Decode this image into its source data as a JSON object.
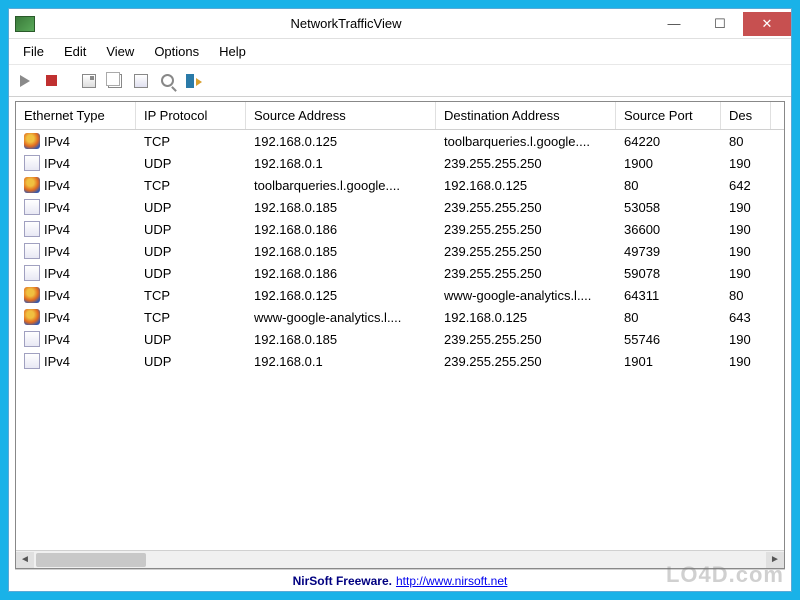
{
  "window": {
    "title": "NetworkTrafficView"
  },
  "menus": [
    "File",
    "Edit",
    "View",
    "Options",
    "Help"
  ],
  "columns": [
    "Ethernet Type",
    "IP Protocol",
    "Source Address",
    "Destination Address",
    "Source Port",
    "Des"
  ],
  "rows": [
    {
      "icon": "firefox",
      "eth": "IPv4",
      "proto": "TCP",
      "src": "192.168.0.125",
      "dst": "toolbarqueries.l.google....",
      "sport": "64220",
      "dport": "80"
    },
    {
      "icon": "generic",
      "eth": "IPv4",
      "proto": "UDP",
      "src": "192.168.0.1",
      "dst": "239.255.255.250",
      "sport": "1900",
      "dport": "190"
    },
    {
      "icon": "firefox",
      "eth": "IPv4",
      "proto": "TCP",
      "src": "toolbarqueries.l.google....",
      "dst": "192.168.0.125",
      "sport": "80",
      "dport": "642"
    },
    {
      "icon": "generic",
      "eth": "IPv4",
      "proto": "UDP",
      "src": "192.168.0.185",
      "dst": "239.255.255.250",
      "sport": "53058",
      "dport": "190"
    },
    {
      "icon": "generic",
      "eth": "IPv4",
      "proto": "UDP",
      "src": "192.168.0.186",
      "dst": "239.255.255.250",
      "sport": "36600",
      "dport": "190"
    },
    {
      "icon": "generic",
      "eth": "IPv4",
      "proto": "UDP",
      "src": "192.168.0.185",
      "dst": "239.255.255.250",
      "sport": "49739",
      "dport": "190"
    },
    {
      "icon": "generic",
      "eth": "IPv4",
      "proto": "UDP",
      "src": "192.168.0.186",
      "dst": "239.255.255.250",
      "sport": "59078",
      "dport": "190"
    },
    {
      "icon": "firefox",
      "eth": "IPv4",
      "proto": "TCP",
      "src": "192.168.0.125",
      "dst": "www-google-analytics.l....",
      "sport": "64311",
      "dport": "80"
    },
    {
      "icon": "firefox",
      "eth": "IPv4",
      "proto": "TCP",
      "src": "www-google-analytics.l....",
      "dst": "192.168.0.125",
      "sport": "80",
      "dport": "643"
    },
    {
      "icon": "generic",
      "eth": "IPv4",
      "proto": "UDP",
      "src": "192.168.0.185",
      "dst": "239.255.255.250",
      "sport": "55746",
      "dport": "190"
    },
    {
      "icon": "generic",
      "eth": "IPv4",
      "proto": "UDP",
      "src": "192.168.0.1",
      "dst": "239.255.255.250",
      "sport": "1901",
      "dport": "190"
    }
  ],
  "status": {
    "brand": "NirSoft Freeware.",
    "link_text": "http://www.nirsoft.net"
  },
  "watermark": "LO4D.com"
}
